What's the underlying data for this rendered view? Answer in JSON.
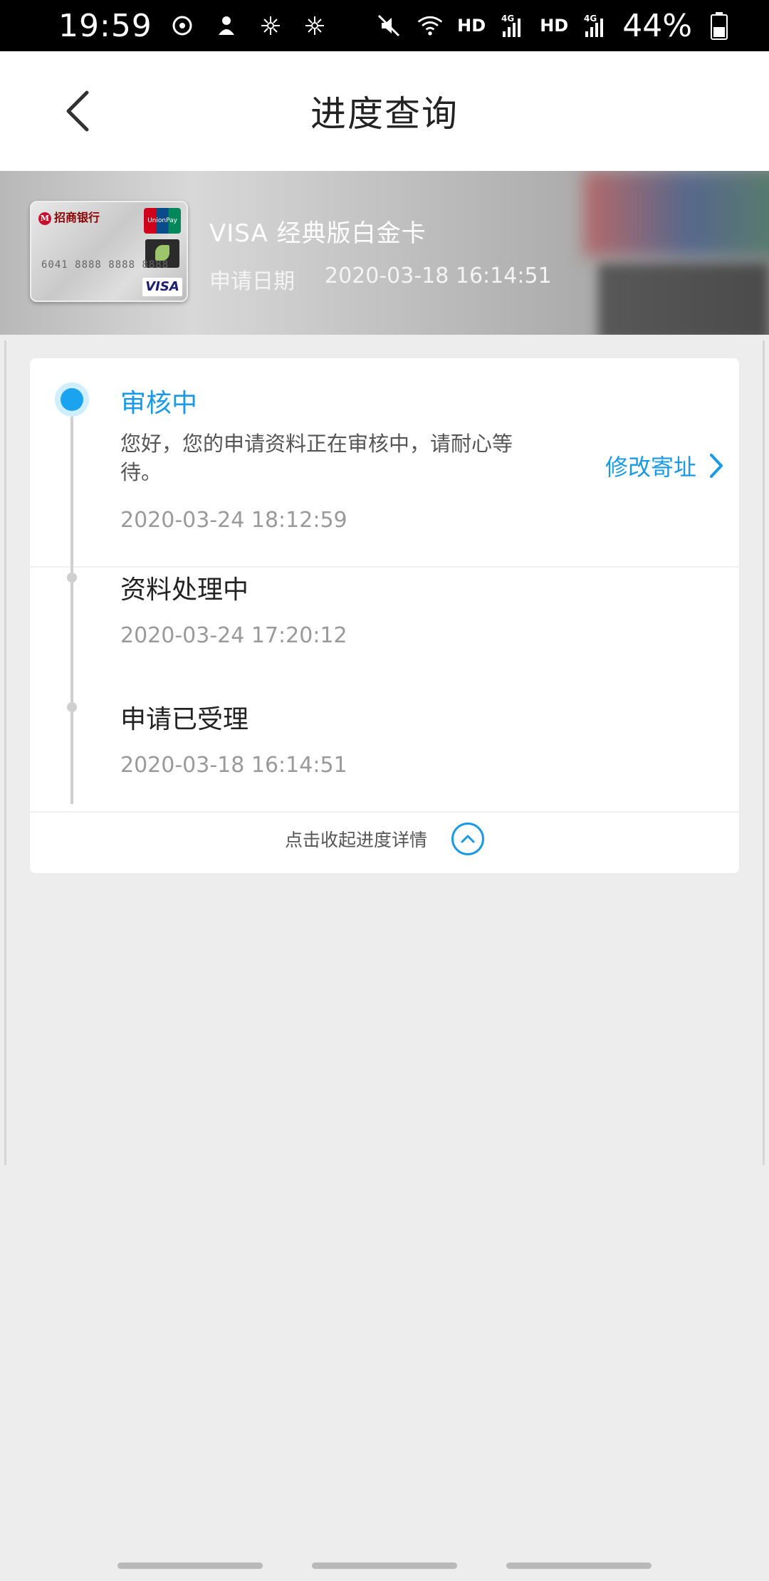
{
  "status_bar": {
    "time": "19:59",
    "battery": "44%",
    "network_labels": [
      "HD",
      "4G",
      "HD",
      "4G"
    ]
  },
  "header": {
    "title": "进度查询"
  },
  "card": {
    "name": "VISA 经典版白金卡",
    "date_label": "申请日期",
    "date_value": "2020-03-18 16:14:51",
    "bank_logo_text": "招商银行",
    "unionpay_text": "UnionPay 银联",
    "number_text": "6041 8888 8888 8888",
    "brand_text": "VISA"
  },
  "progress": {
    "steps": [
      {
        "title": "审核中",
        "description": "您好，您的申请资料正在审核中，请耐心等待。",
        "time": "2020-03-24 18:12:59",
        "active": true
      },
      {
        "title": "资料处理中",
        "time": "2020-03-24 17:20:12",
        "active": false
      },
      {
        "title": "申请已受理",
        "time": "2020-03-18 16:14:51",
        "active": false
      }
    ],
    "modify_label": "修改寄址",
    "collapse_label": "点击收起进度详情"
  },
  "colors": {
    "accent": "#1a9ae6",
    "background": "#ededed",
    "timeline": "#cfcfcf"
  },
  "icons": [
    "back-arrow-icon",
    "chevron-right-icon",
    "chevron-up-icon",
    "wifi-icon",
    "signal-icon",
    "battery-icon",
    "mute-icon"
  ]
}
